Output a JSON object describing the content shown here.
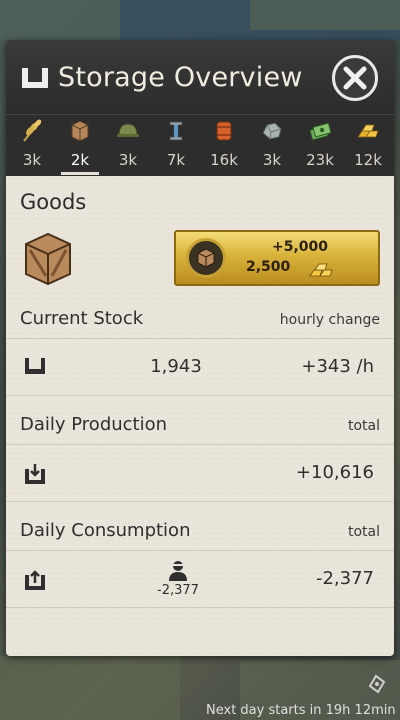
{
  "header": {
    "title": "Storage Overview"
  },
  "tabs": [
    {
      "icon": "wheat-icon",
      "value": "3k"
    },
    {
      "icon": "crate-icon",
      "value": "2k",
      "active": true
    },
    {
      "icon": "helmet-icon",
      "value": "3k"
    },
    {
      "icon": "steel-beam-icon",
      "value": "7k"
    },
    {
      "icon": "oil-barrel-icon",
      "value": "16k"
    },
    {
      "icon": "ore-icon",
      "value": "3k"
    },
    {
      "icon": "money-icon",
      "value": "23k"
    },
    {
      "icon": "gold-bars-icon",
      "value": "12k"
    }
  ],
  "goods": {
    "title": "Goods",
    "buy_amount": "+5,000",
    "buy_cost": "2,500"
  },
  "current_stock": {
    "label": "Current Stock",
    "sub": "hourly change",
    "value": "1,943",
    "change": "+343 /h"
  },
  "daily_production": {
    "label": "Daily Production",
    "sub": "total",
    "value": "+10,616"
  },
  "daily_consumption": {
    "label": "Daily Consumption",
    "sub": "total",
    "citizen_value": "-2,377",
    "value": "-2,377"
  },
  "footer": {
    "text": "Next day starts in 19h 12min"
  },
  "colors": {
    "gold": "#d9b33a",
    "panel": "#2b2b2b",
    "parchment": "#e9e5da"
  }
}
